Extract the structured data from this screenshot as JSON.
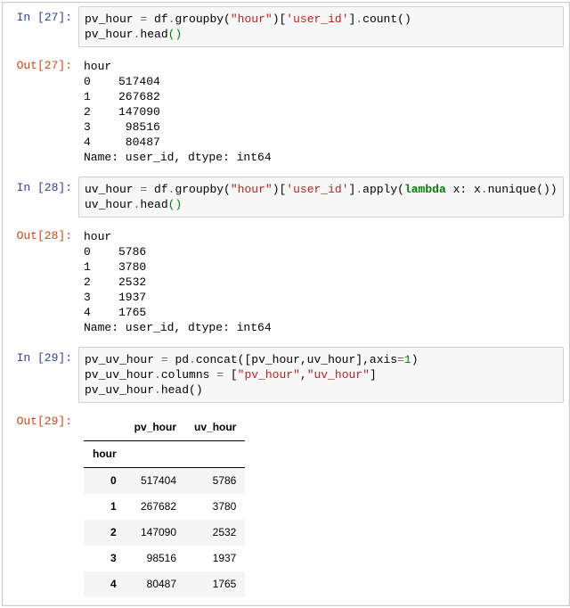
{
  "prompts": {
    "in": "In ",
    "out": "Out"
  },
  "cells": {
    "c27": {
      "num": "27",
      "code_tokens": [
        {
          "t": "pv_hour ",
          "c": ""
        },
        {
          "t": "=",
          "c": "c-op"
        },
        {
          "t": " df",
          "c": ""
        },
        {
          "t": ".",
          "c": "c-op"
        },
        {
          "t": "groupby(",
          "c": ""
        },
        {
          "t": "\"hour\"",
          "c": "c-str"
        },
        {
          "t": ")[",
          "c": ""
        },
        {
          "t": "'user_id'",
          "c": "c-str"
        },
        {
          "t": "]",
          "c": ""
        },
        {
          "t": ".",
          "c": "c-op"
        },
        {
          "t": "count()",
          "c": ""
        },
        {
          "t": "\n",
          "c": ""
        },
        {
          "t": "pv_hour",
          "c": ""
        },
        {
          "t": ".",
          "c": "c-op"
        },
        {
          "t": "head",
          "c": ""
        },
        {
          "t": "()",
          "c": "c-num"
        }
      ],
      "output": "hour\n0    517404\n1    267682\n2    147090\n3     98516\n4     80487\nName: user_id, dtype: int64"
    },
    "c28": {
      "num": "28",
      "code_tokens": [
        {
          "t": "uv_hour ",
          "c": ""
        },
        {
          "t": "=",
          "c": "c-op"
        },
        {
          "t": " df",
          "c": ""
        },
        {
          "t": ".",
          "c": "c-op"
        },
        {
          "t": "groupby(",
          "c": ""
        },
        {
          "t": "\"hour\"",
          "c": "c-str"
        },
        {
          "t": ")[",
          "c": ""
        },
        {
          "t": "'user_id'",
          "c": "c-str"
        },
        {
          "t": "]",
          "c": ""
        },
        {
          "t": ".",
          "c": "c-op"
        },
        {
          "t": "apply(",
          "c": ""
        },
        {
          "t": "lambda",
          "c": "c-kw"
        },
        {
          "t": " x: x",
          "c": ""
        },
        {
          "t": ".",
          "c": "c-op"
        },
        {
          "t": "nunique())",
          "c": ""
        },
        {
          "t": "\n",
          "c": ""
        },
        {
          "t": "uv_hour",
          "c": ""
        },
        {
          "t": ".",
          "c": "c-op"
        },
        {
          "t": "head",
          "c": ""
        },
        {
          "t": "()",
          "c": "c-num"
        }
      ],
      "output": "hour\n0    5786\n1    3780\n2    2532\n3    1937\n4    1765\nName: user_id, dtype: int64"
    },
    "c29": {
      "num": "29",
      "code_tokens": [
        {
          "t": "pv_uv_hour ",
          "c": ""
        },
        {
          "t": "=",
          "c": "c-op"
        },
        {
          "t": " pd",
          "c": ""
        },
        {
          "t": ".",
          "c": "c-op"
        },
        {
          "t": "concat([pv_hour,uv_hour],axis",
          "c": ""
        },
        {
          "t": "=",
          "c": "c-op"
        },
        {
          "t": "1",
          "c": "c-num"
        },
        {
          "t": ")",
          "c": ""
        },
        {
          "t": "\n",
          "c": ""
        },
        {
          "t": "pv_uv_hour",
          "c": ""
        },
        {
          "t": ".",
          "c": "c-op"
        },
        {
          "t": "columns ",
          "c": ""
        },
        {
          "t": "=",
          "c": "c-op"
        },
        {
          "t": " [",
          "c": ""
        },
        {
          "t": "\"pv_hour\"",
          "c": "c-str"
        },
        {
          "t": ",",
          "c": ""
        },
        {
          "t": "\"uv_hour\"",
          "c": "c-str"
        },
        {
          "t": "]",
          "c": ""
        },
        {
          "t": "\n",
          "c": ""
        },
        {
          "t": "pv_uv_hour",
          "c": ""
        },
        {
          "t": ".",
          "c": "c-op"
        },
        {
          "t": "head()",
          "c": ""
        }
      ],
      "table": {
        "index_name": "hour",
        "columns": [
          "pv_hour",
          "uv_hour"
        ],
        "rows": [
          {
            "idx": "0",
            "vals": [
              "517404",
              "5786"
            ]
          },
          {
            "idx": "1",
            "vals": [
              "267682",
              "3780"
            ]
          },
          {
            "idx": "2",
            "vals": [
              "147090",
              "2532"
            ]
          },
          {
            "idx": "3",
            "vals": [
              "98516",
              "1937"
            ]
          },
          {
            "idx": "4",
            "vals": [
              "80487",
              "1765"
            ]
          }
        ]
      }
    }
  }
}
